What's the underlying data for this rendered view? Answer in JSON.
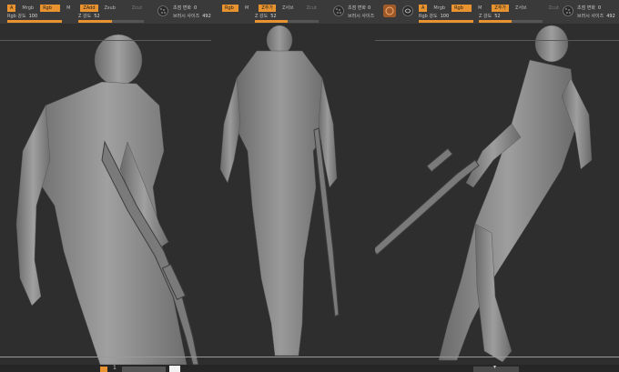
{
  "toolbar_1": {
    "mode": "A",
    "mrgb": "Mrgb",
    "rgb": "Rgb",
    "m": "M",
    "zadd": "ZAdd",
    "zsub": "Zsub",
    "zcut": "Zcut",
    "rgb_intensity_label": "Rgb 강도",
    "rgb_intensity_value": "100",
    "z_intensity_label": "Z 강도",
    "z_intensity_value": "52"
  },
  "toolbar_2": {
    "focal_shift_label": "초점 변화",
    "focal_shift_value": "0",
    "draw_size_label": "브러시 사이즈",
    "draw_size_value": "492",
    "rgb": "Rgb",
    "m": "M",
    "zadd": "Z추가",
    "zsub": "Z서브",
    "zcut": "Zcut",
    "z_intensity_label": "Z 강도",
    "z_intensity_value": "52",
    "focal_shift_label_b": "초점 변화",
    "focal_shift_value_b": "0",
    "draw_size_label_b": "브러시 사이즈"
  },
  "toolbar_3": {
    "mode": "A",
    "mrgb": "Mrgb",
    "rgb": "Rgb",
    "m": "M",
    "zadd": "Z추가",
    "zsub": "Z서브",
    "zcut": "Zcut",
    "rgb_intensity_label": "Rgb 강도",
    "rgb_intensity_value": "100",
    "z_intensity_label": "Z 강도",
    "z_intensity_value": "52",
    "focal_shift_label": "초점 변화",
    "focal_shift_value": "0",
    "draw_size_label": "브러시 사이즈",
    "draw_size_value": "492"
  },
  "bottom": {
    "page_number": "1"
  },
  "colors": {
    "accent": "#e8932f",
    "background": "#2e2e2e",
    "toolbar": "#3a3a3a",
    "sculpt": "#8c8c8c"
  },
  "icons": [
    "material-sphere-icon",
    "stroke-dots-icon",
    "alpha-swirl-icon"
  ]
}
